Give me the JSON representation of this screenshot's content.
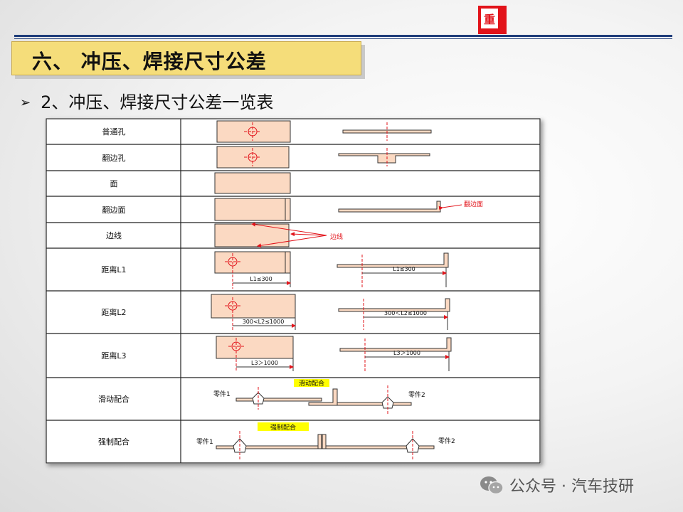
{
  "header": {
    "logo_glyph": "重",
    "brand_color": "#e2131a"
  },
  "title": "六、 冲压、焊接尺寸公差",
  "subtitle": {
    "text": "2、冲压、焊接尺寸公差一览表"
  },
  "table": {
    "rows": [
      {
        "label": "普通孔"
      },
      {
        "label": "翻边孔"
      },
      {
        "label": "面"
      },
      {
        "label": "翻边面"
      },
      {
        "label": "边线"
      },
      {
        "label": "距离L1"
      },
      {
        "label": "距离L2"
      },
      {
        "label": "距离L3"
      },
      {
        "label": "滑动配合"
      },
      {
        "label": "强制配合"
      }
    ],
    "annotations": {
      "flange_face": "翻边面",
      "edge_line": "边线",
      "l1": "L1≤300",
      "l2": "300<L2≤1000",
      "l3": "L3＞1000",
      "l2_right": "300＜L2≤1000",
      "part1": "零件1",
      "part2": "零件2",
      "slide_fit": "滑动配合",
      "force_fit": "强制配合"
    }
  },
  "footer": {
    "text": "公众号 · 汽车技研"
  }
}
